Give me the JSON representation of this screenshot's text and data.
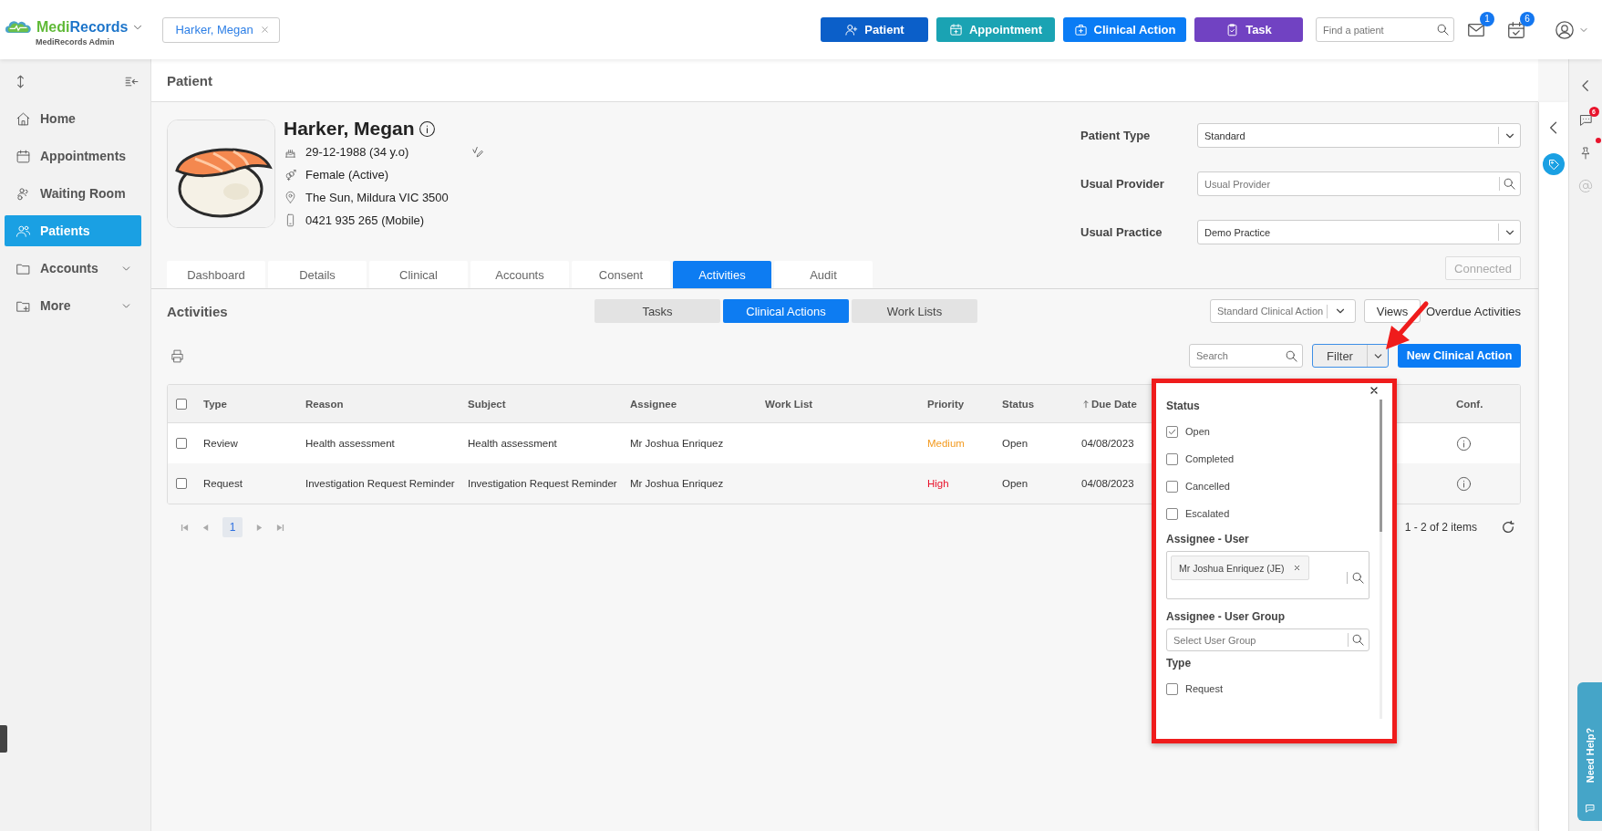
{
  "brand": {
    "name": "MediRecords",
    "subtitle": "MediRecords Admin"
  },
  "open_patient": {
    "label": "Harker, Megan"
  },
  "quick_actions": [
    {
      "label": "Patient",
      "kind": "patient",
      "color": "#0b5fc9"
    },
    {
      "label": "Appointment",
      "kind": "appointment",
      "color": "#1aa3b3"
    },
    {
      "label": "Clinical Action",
      "kind": "clinical",
      "color": "#0a7cf5"
    },
    {
      "label": "Task",
      "kind": "task",
      "color": "#7142c2"
    }
  ],
  "patient_search": {
    "placeholder": "Find a patient"
  },
  "notifications": [
    {
      "kind": "mail",
      "count": "1"
    },
    {
      "kind": "tasks",
      "count": "6"
    }
  ],
  "sidebar": {
    "items": [
      {
        "label": "Home",
        "kind": "home",
        "selected": false,
        "expandable": false
      },
      {
        "label": "Appointments",
        "kind": "calendar",
        "selected": false,
        "expandable": false
      },
      {
        "label": "Waiting Room",
        "kind": "waiting",
        "selected": false,
        "expandable": false
      },
      {
        "label": "Patients",
        "kind": "people",
        "selected": true,
        "expandable": false
      },
      {
        "label": "Accounts",
        "kind": "folder",
        "selected": false,
        "expandable": true
      },
      {
        "label": "More",
        "kind": "more",
        "selected": false,
        "expandable": true
      }
    ]
  },
  "page": {
    "title": "Patient"
  },
  "patient": {
    "name": "Harker, Megan",
    "details": [
      {
        "kind": "dob",
        "text": "29-12-1988 (34 y.o)"
      },
      {
        "kind": "gender",
        "text": "Female (Active)"
      },
      {
        "kind": "address",
        "text": "The Sun, Mildura VIC 3500"
      },
      {
        "kind": "phone",
        "text": "0421 935 265 (Mobile)"
      }
    ]
  },
  "patient_fields": [
    {
      "label": "Patient Type",
      "kind": "select",
      "value": "Standard"
    },
    {
      "label": "Usual Provider",
      "kind": "lookup",
      "placeholder": "Usual Provider"
    },
    {
      "label": "Usual Practice",
      "kind": "select",
      "value": "Demo Practice"
    }
  ],
  "connection": {
    "label": "Connected",
    "disabled": true
  },
  "tabs": [
    {
      "label": "Dashboard",
      "selected": false
    },
    {
      "label": "Details",
      "selected": false
    },
    {
      "label": "Clinical",
      "selected": false
    },
    {
      "label": "Accounts",
      "selected": false
    },
    {
      "label": "Consent",
      "selected": false
    },
    {
      "label": "Activities",
      "selected": true
    },
    {
      "label": "Audit",
      "selected": false
    }
  ],
  "activities": {
    "title": "Activities",
    "segments": [
      {
        "label": "Tasks",
        "selected": false
      },
      {
        "label": "Clinical Actions",
        "selected": true
      },
      {
        "label": "Work Lists",
        "selected": false
      }
    ],
    "view": {
      "placeholder": "Standard Clinical Action"
    },
    "views_button": "Views",
    "overdue": "Overdue Activities",
    "search": {
      "placeholder": "Search"
    },
    "filter": {
      "label": "Filter",
      "open": true
    },
    "new_button": "New Clinical Action"
  },
  "table": {
    "all_checked": false,
    "columns": [
      {
        "label": "Type",
        "sorted": false
      },
      {
        "label": "Reason",
        "sorted": false
      },
      {
        "label": "Subject",
        "sorted": false
      },
      {
        "label": "Assignee",
        "sorted": false
      },
      {
        "label": "Work List",
        "sorted": false
      },
      {
        "label": "Priority",
        "sorted": false
      },
      {
        "label": "Status",
        "sorted": false
      },
      {
        "label": "Due Date",
        "sorted": true
      },
      {
        "label": "Conf.",
        "sorted": false
      }
    ],
    "rows": [
      {
        "checked": false,
        "type": "Review",
        "reason": "Health assessment",
        "subject": "Health assessment",
        "assignee": "Mr Joshua Enriquez",
        "priority": {
          "text": "Medium",
          "color": "#f39a1e"
        },
        "status": "Open",
        "due_date": "04/08/2023"
      },
      {
        "checked": false,
        "type": "Request",
        "reason": "Investigation Request Reminder",
        "subject": "Investigation Request Reminder",
        "assignee": "Mr Joshua Enriquez",
        "priority": {
          "text": "High",
          "color": "#e8142c"
        },
        "status": "Open",
        "due_date": "04/08/2023"
      }
    ]
  },
  "pagination": {
    "pages": [
      {
        "label": "1",
        "selected": true
      }
    ],
    "summary": "1 - 2 of 2 items"
  },
  "filter_panel": {
    "sections": [
      {
        "kind": "checks",
        "title": "Status",
        "options": [
          {
            "label": "Open",
            "checked": true
          },
          {
            "label": "Completed",
            "checked": false
          },
          {
            "label": "Cancelled",
            "checked": false
          },
          {
            "label": "Escalated",
            "checked": false
          }
        ]
      },
      {
        "kind": "tags",
        "title": "Assignee - User",
        "tags": [
          "Mr Joshua Enriquez (JE)"
        ]
      },
      {
        "kind": "search",
        "title": "Assignee - User Group",
        "placeholder": "Select User Group"
      },
      {
        "kind": "checks",
        "title": "Type",
        "options": [
          {
            "label": "Request",
            "checked": false
          }
        ]
      }
    ]
  },
  "right_panel": {
    "chat_count": "6",
    "pin_alert": true
  },
  "help": {
    "label": "Need Help?"
  }
}
